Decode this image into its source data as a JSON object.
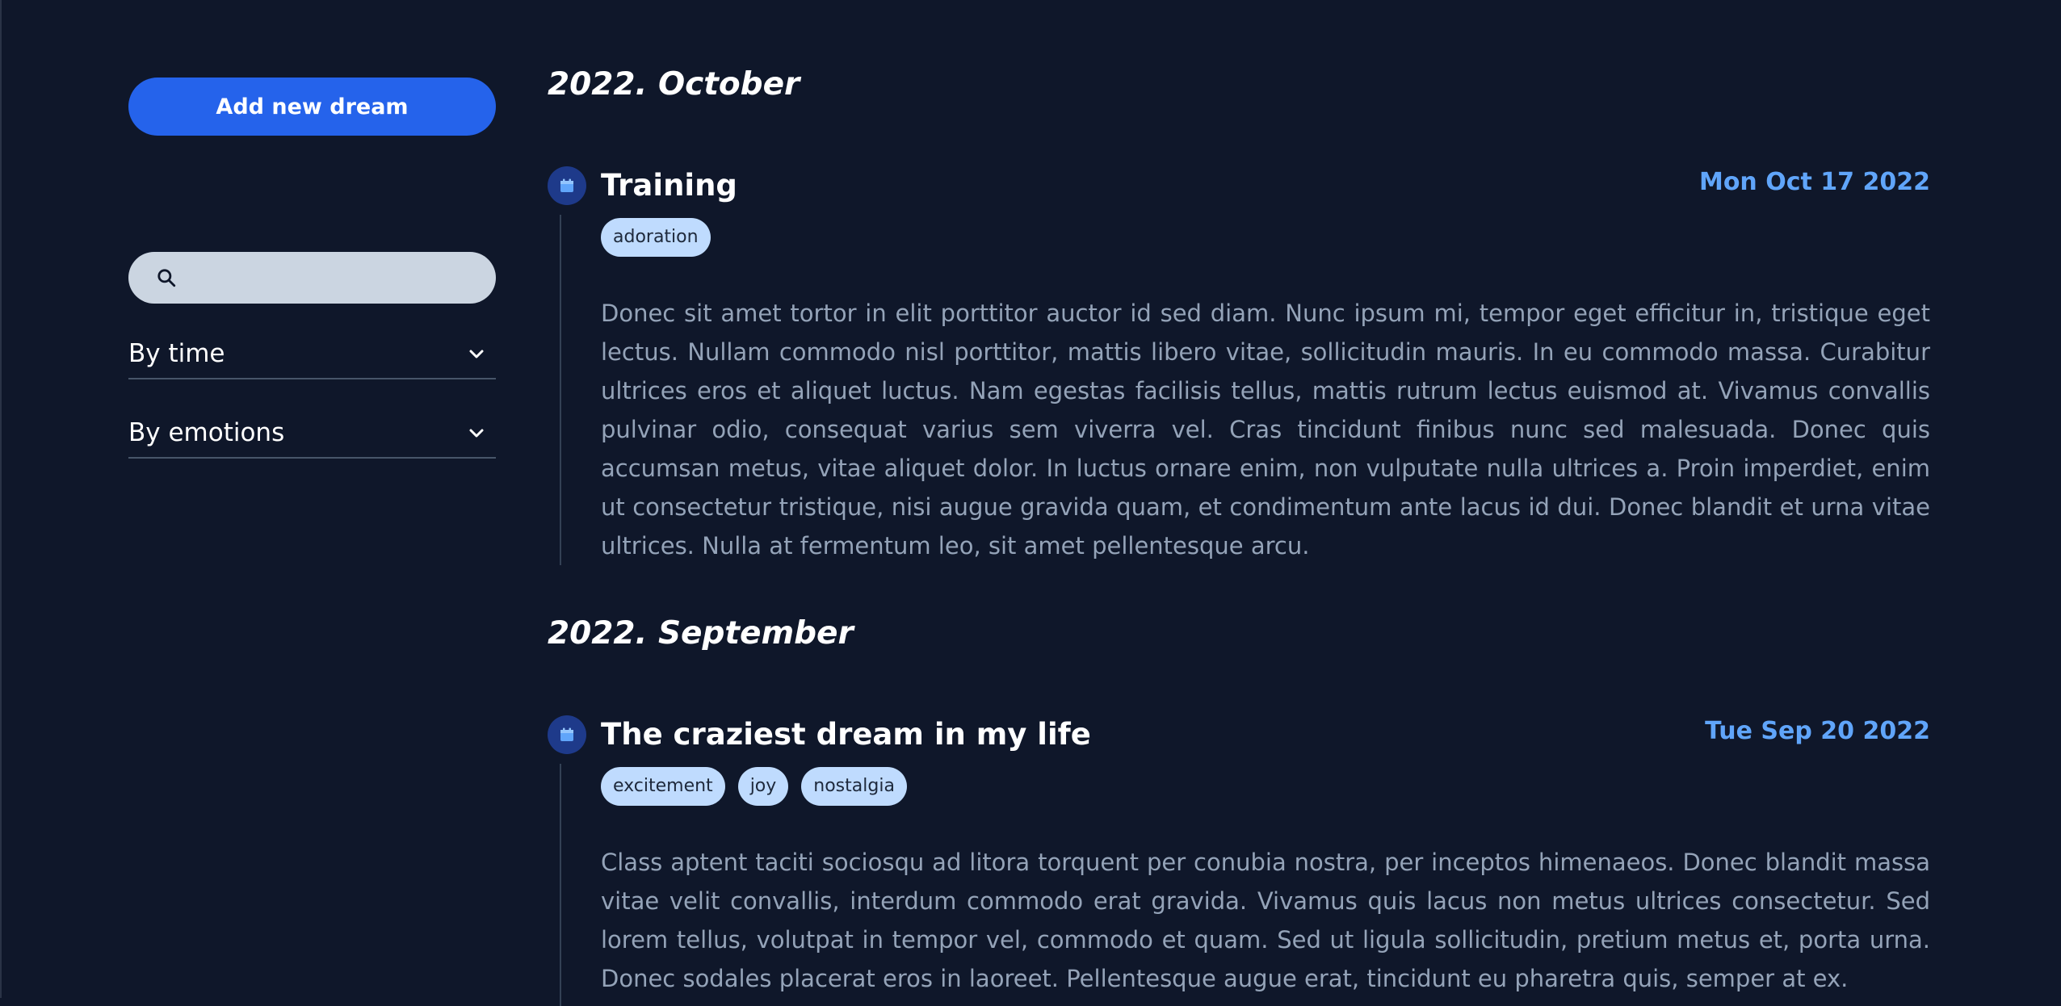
{
  "sidebar": {
    "add_button_label": "Add new dream",
    "search": {
      "value": "",
      "placeholder": "",
      "icon": "search-icon"
    },
    "filters": [
      {
        "label": "By time",
        "icon": "chevron-down-icon"
      },
      {
        "label": "By emotions",
        "icon": "chevron-down-icon"
      }
    ]
  },
  "timeline": [
    {
      "month": "2022. October",
      "entries": [
        {
          "title": "Training",
          "date": "Mon Oct 17 2022",
          "icon": "calendar-icon",
          "tags": [
            "adoration"
          ],
          "body": "Donec sit amet tortor in elit porttitor auctor id sed diam. Nunc ipsum mi, tempor eget efficitur in, tristique eget lectus. Nullam commodo nisl porttitor, mattis libero vitae, sollicitudin mauris. In eu commodo massa. Curabitur ultrices eros et aliquet luctus. Nam egestas facilisis tellus, mattis rutrum lectus euismod at. Vivamus convallis pulvinar odio, consequat varius sem viverra vel. Cras tincidunt finibus nunc sed malesuada. Donec quis accumsan metus, vitae aliquet dolor. In luctus ornare enim, non vulputate nulla ultrices a. Proin imperdiet, enim ut consectetur tristique, nisi augue gravida quam, et condimentum ante lacus id dui. Donec blandit et urna vitae ultrices. Nulla at fermentum leo, sit amet pellentesque arcu."
        }
      ]
    },
    {
      "month": "2022. September",
      "entries": [
        {
          "title": "The craziest dream in my life",
          "date": "Tue Sep 20 2022",
          "icon": "calendar-icon",
          "tags": [
            "excitement",
            "joy",
            "nostalgia"
          ],
          "body": "Class aptent taciti sociosqu ad litora torquent per conubia nostra, per inceptos himenaeos. Donec blandit massa vitae velit convallis, interdum commodo erat gravida. Vivamus quis lacus non metus ultrices consectetur. Sed lorem tellus, volutpat in tempor vel, commodo et quam. Sed ut ligula sollicitudin, pretium metus et, porta urna. Donec sodales placerat eros in laoreet. Pellentesque augue erat, tincidunt eu pharetra quis, semper at ex."
        }
      ]
    }
  ],
  "colors": {
    "background": "#0f172a",
    "accent": "#2563eb",
    "date": "#60a5fa",
    "tag": "#bfdbfe",
    "marker": "#1e3a8a"
  }
}
